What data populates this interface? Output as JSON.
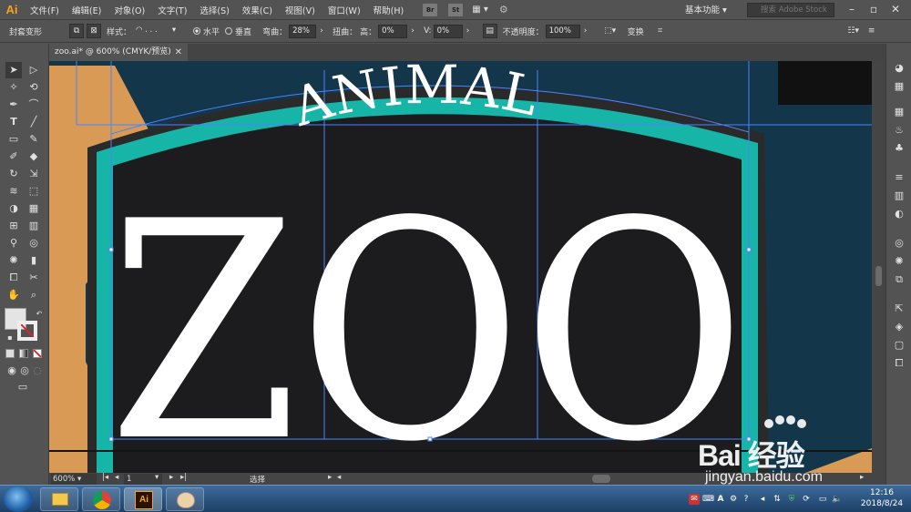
{
  "app": {
    "logo": "Ai",
    "menus": [
      "文件(F)",
      "编辑(E)",
      "对象(O)",
      "文字(T)",
      "选择(S)",
      "效果(C)",
      "视图(V)",
      "窗口(W)",
      "帮助(H)"
    ],
    "bridge_icon": "Br",
    "stock_icon": "St",
    "workspace_label": "基本功能",
    "stock_search_placeholder": "搜索 Adobe Stock"
  },
  "control_bar": {
    "envelope_label": "封套变形",
    "style_label": "样式：",
    "horizontal_label": "水平",
    "vertical_label": "垂直",
    "bend_label": "弯曲：",
    "bend_value": "28%",
    "distort_label": "扭曲：",
    "distort_h_label": "高：",
    "distort_h_value": "0%",
    "distort_v_label": "V:",
    "distort_v_value": "0%",
    "opacity_label": "不透明度：",
    "opacity_value": "100%",
    "transform_label": "变换",
    "orientation": "horizontal"
  },
  "document": {
    "tab_title": "zoo.ai* @ 600% (CMYK/预览)"
  },
  "artwork": {
    "arc_text": "ANIMAL",
    "main_text": "ZOO",
    "colors": {
      "background": "#14364a",
      "badge": "#1c1c1e",
      "badge_outline": "#2a2a2a",
      "teal": "#17b4a8",
      "orange": "#d89a55",
      "text": "#ffffff",
      "guide": "#4a84ff"
    }
  },
  "status_bar": {
    "zoom": "600%",
    "artboard_number": "1",
    "tool_name": "选择"
  },
  "taskbar": {
    "apps": [
      "explorer-icon",
      "chrome-icon",
      "illustrator-icon",
      "paint-icon"
    ],
    "active_app": "Ai",
    "time": "12:16",
    "date": "2018/8/24"
  },
  "watermark": {
    "brand": "Bai 经验",
    "url": "jingyan.baidu.com"
  }
}
